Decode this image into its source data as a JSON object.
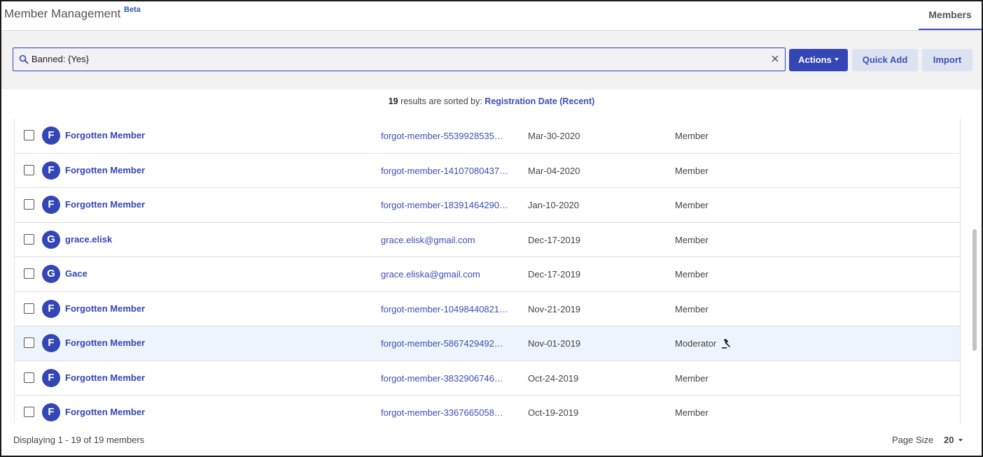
{
  "header": {
    "title": "Member Management",
    "badge": "Beta",
    "tab_label": "Members"
  },
  "search": {
    "value": "Banned: {Yes}"
  },
  "toolbar": {
    "actions_label": "Actions",
    "quick_add_label": "Quick Add",
    "import_label": "Import"
  },
  "results": {
    "count": "19",
    "text": "results are sorted by:",
    "sort_label": "Registration Date (Recent)"
  },
  "members": [
    {
      "initial": "F",
      "name": "Forgotten Member",
      "email": "forgot-member-5539928535…",
      "date": "Mar-30-2020",
      "role": "Member"
    },
    {
      "initial": "F",
      "name": "Forgotten Member",
      "email": "forgot-member-14107080437…",
      "date": "Mar-04-2020",
      "role": "Member"
    },
    {
      "initial": "F",
      "name": "Forgotten Member",
      "email": "forgot-member-18391464290…",
      "date": "Jan-10-2020",
      "role": "Member"
    },
    {
      "initial": "G",
      "name": "grace.elisk",
      "email": "grace.elisk@gmail.com",
      "date": "Dec-17-2019",
      "role": "Member"
    },
    {
      "initial": "G",
      "name": "Gace",
      "email": "grace.eliska@gmail.com",
      "date": "Dec-17-2019",
      "role": "Member"
    },
    {
      "initial": "F",
      "name": "Forgotten Member",
      "email": "forgot-member-10498440821…",
      "date": "Nov-21-2019",
      "role": "Member"
    },
    {
      "initial": "F",
      "name": "Forgotten Member",
      "email": "forgot-member-5867429492…",
      "date": "Nov-01-2019",
      "role": "Moderator",
      "role_icon": "gavel-icon",
      "highlighted": true
    },
    {
      "initial": "F",
      "name": "Forgotten Member",
      "email": "forgot-member-3832906746…",
      "date": "Oct-24-2019",
      "role": "Member"
    },
    {
      "initial": "F",
      "name": "Forgotten Member",
      "email": "forgot-member-3367665058…",
      "date": "Oct-19-2019",
      "role": "Member"
    }
  ],
  "footer": {
    "displaying": "Displaying 1 - 19 of 19 members",
    "page_size_label": "Page Size",
    "page_size_value": "20"
  },
  "colors": {
    "accent": "#3446b5",
    "link": "#3a50b8",
    "highlight_row": "#eef4fb"
  }
}
